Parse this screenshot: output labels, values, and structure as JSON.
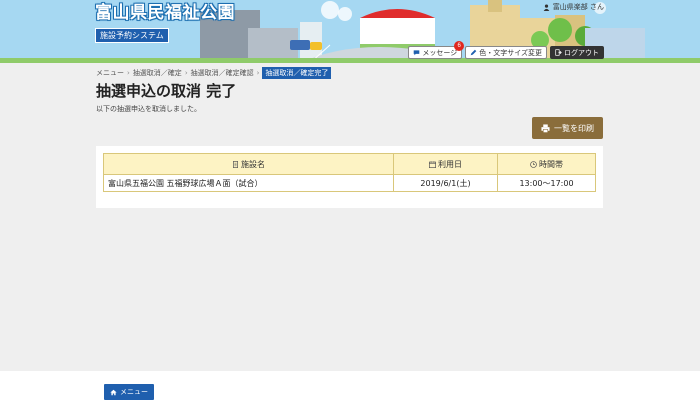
{
  "header": {
    "site_title": "富山県民福祉公園",
    "subtitle": "施設予約システム",
    "user_label": "富山県楽部 さん",
    "buttons": {
      "message_label": "メッセージ",
      "message_count": "6",
      "display_label": "色・文字サイズ変更",
      "logout_label": "ログアウト"
    }
  },
  "breadcrumb": {
    "items": [
      "メニュー",
      "抽選取消／確定",
      "抽選取消／確定確認"
    ],
    "current": "抽選取消／確定完了",
    "separator": "›"
  },
  "page": {
    "title": "抽選申込の取消 完了",
    "description": "以下の抽選申込を取消しました。",
    "print_label": "一覧を印刷"
  },
  "table": {
    "headers": {
      "facility": "施設名",
      "date": "利用日",
      "time": "時間帯"
    },
    "rows": [
      {
        "facility": "富山県五福公園 五福野球広場Ａ面（試合）",
        "date": "2019/6/1(土)",
        "time": "13:00〜17:00"
      }
    ]
  },
  "footer": {
    "menu_label": "メニュー"
  },
  "colors": {
    "brand_blue": "#1f5fae",
    "print_brown": "#8a6d3b",
    "table_header": "#fdf3c4"
  }
}
